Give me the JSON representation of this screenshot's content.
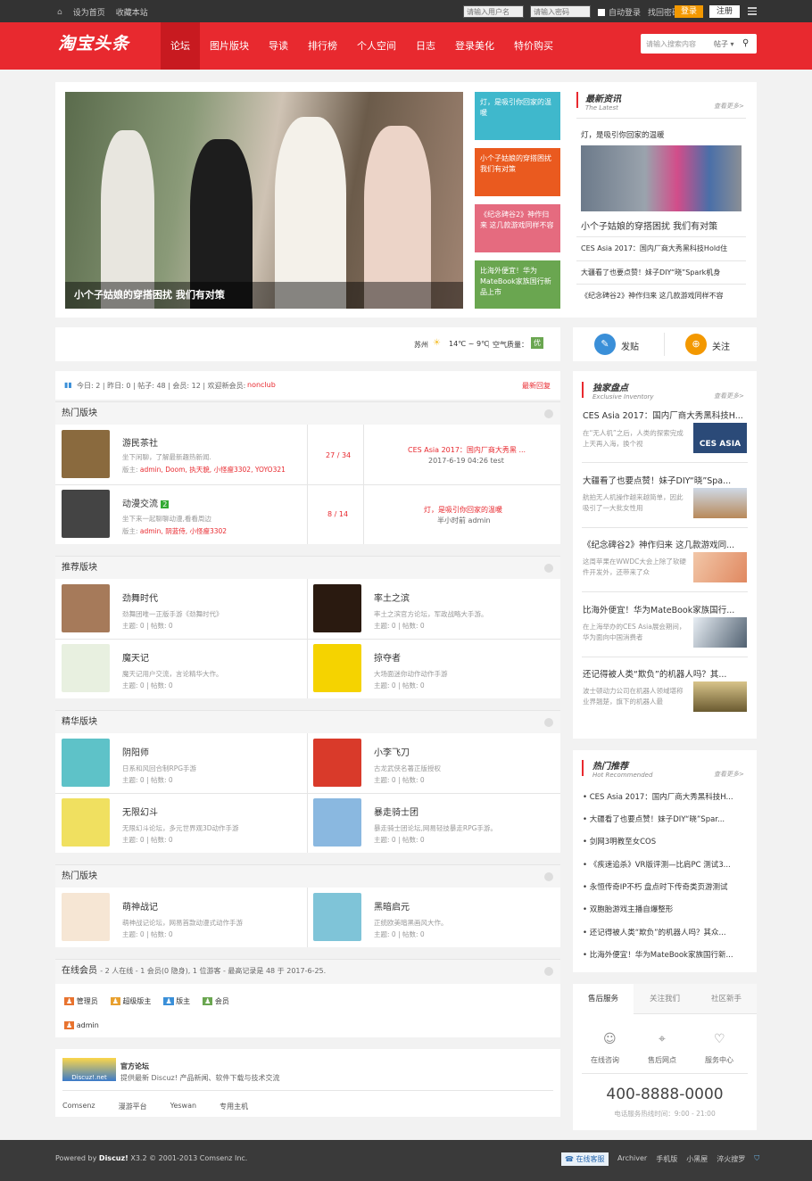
{
  "topbar": {
    "home": "设为首页",
    "fav": "收藏本站",
    "user_ph": "请输入用户名",
    "pwd_ph": "请输入密码",
    "auto": "自动登录",
    "find": "找回密码",
    "login": "登录",
    "register": "注册"
  },
  "header": {
    "logo": "淘宝头条",
    "nav": [
      "论坛",
      "图片版块",
      "导读",
      "排行榜",
      "个人空间",
      "日志",
      "登录美化",
      "特价购买"
    ],
    "search_ph": "请输入搜索内容",
    "search_sel": "帖子"
  },
  "slider": {
    "caption": "小个子姑娘的穿搭困扰 我们有对策"
  },
  "tiles": [
    {
      "text": "灯，是吸引你回家的温暖",
      "color": "#3fb8cc"
    },
    {
      "text": "小个子姑娘的穿搭困扰 我们有对策",
      "color": "#ea5a1f"
    },
    {
      "text": "《纪念碑谷2》神作归来 这几款游戏同样不容",
      "color": "#e56b7f"
    },
    {
      "text": "比海外便宜！华为MateBook家族国行新品上市",
      "color": "#6aa650"
    }
  ],
  "latest": {
    "title": "最新资讯",
    "sub": "The Latest",
    "more": "查看更多>",
    "top": "灯，是吸引你回家的温暖",
    "caption": "小个子姑娘的穿搭困扰 我们有对策",
    "items": [
      "CES Asia 2017：国内厂商大秀黑科技Hold住",
      "大疆看了也要点赞！妹子DIY“晓”Spark机身",
      "《纪念碑谷2》神作归来 这几款游戏同样不容"
    ]
  },
  "weather": {
    "city": "苏州",
    "temp": "14℃ ~ 9℃",
    "air": "空气质量：",
    "level": "优"
  },
  "actions": {
    "post": "发贴",
    "follow": "关注"
  },
  "stats": {
    "text": "今日: 2 | 昨日: 0 | 帖子: 48 | 会员: 12 | 欢迎新会员:",
    "newuser": "nonclub",
    "latest": "最新回复"
  },
  "hot1": {
    "title": "热门版块",
    "forums": [
      {
        "name": "游民茶社",
        "desc": "坐下闲聊，了解最新趣热新闻.",
        "mods_label": "版主:",
        "mods": "admin, Doom, 执天貌, 小怪瘦3302, YOYO321",
        "count": "27 / 34",
        "last": "CES Asia 2017：国内厂商大秀黑 ...",
        "lastmeta": "2017-6-19 04:26 test"
      },
      {
        "name": "动漫交流",
        "badge": "2",
        "desc": "坐下来一起聊聊动漫,看看周边",
        "mods_label": "版主:",
        "mods": "admin, 阴蓝侍, 小怪瘦3302",
        "count": "8 / 14",
        "last": "灯，是吸引你回家的温暖",
        "lastmeta": "半小时前 admin"
      }
    ]
  },
  "rec": {
    "title": "推荐版块",
    "forums": [
      {
        "name": "劲舞时代",
        "desc": "劲舞团唯一正版手游《劲舞时代》",
        "stat": "主题: 0  |  帖数: 0"
      },
      {
        "name": "率土之滨",
        "desc": "率土之滨官方论坛，军政战略大手游。",
        "stat": "主题: 0  |  帖数: 0"
      },
      {
        "name": "魔天记",
        "desc": "魔天记用户交流，言论精华大作。",
        "stat": "主题: 0  |  帖数: 0"
      },
      {
        "name": "掠夺者",
        "desc": "大场面迷你动作动作手游",
        "stat": "主题: 0  |  帖数: 0"
      }
    ]
  },
  "elite": {
    "title": "精华版块",
    "forums": [
      {
        "name": "阴阳师",
        "desc": "日系和风回合制RPG手游",
        "stat": "主题: 0  |  帖数: 0"
      },
      {
        "name": "小李飞刀",
        "desc": "古龙武侠名著正版授权",
        "stat": "主题: 0  |  帖数: 0"
      },
      {
        "name": "无限幻斗",
        "desc": "无限幻斗论坛，多元世界观3D动作手游",
        "stat": "主题: 0  |  帖数: 0"
      },
      {
        "name": "暴走骑士团",
        "desc": "暴走骑士团论坛,网易轻技暴走RPG手游。",
        "stat": "主题: 0  |  帖数: 0"
      }
    ]
  },
  "hot2": {
    "title": "热门版块",
    "forums": [
      {
        "name": "萌神战记",
        "desc": "萌神战记论坛，网易首款动漫式动作手游",
        "stat": "主题: 0  |  帖数: 0"
      },
      {
        "name": "黑暗启元",
        "desc": "正统欧美暗黑画风大作。",
        "stat": "主题: 0  |  帖数: 0"
      }
    ]
  },
  "online": {
    "title": "在线会员",
    "info": "- 2 人在线 - 1 会员(0 隐身), 1 位游客 - 最高记录是 48 于 2017-6-25.",
    "roles": [
      "管理员",
      "超级版主",
      "版主",
      "会员"
    ],
    "user": "admin"
  },
  "official": {
    "badge": "Discuz!.net",
    "name": "官方论坛",
    "desc": "提供最新 Discuz! 产品新闻、软件下载与技术交流",
    "links": [
      "Comsenz",
      "漫游平台",
      "Yeswan",
      "专用主机"
    ]
  },
  "inventory": {
    "title": "独家盘点",
    "sub": "Exclusive Inventory",
    "more": "查看更多>",
    "items": [
      {
        "title": "CES Asia 2017：国内厂商大秀黑科技H...",
        "desc": "在“无人机”之后，人类的探索完成上天再入海，换个视",
        "img": "CES ASIA"
      },
      {
        "title": "大疆看了也要点赞！妹子DIY“晓”Spa...",
        "desc": "航拍无人机操作越来越简单，因此吸引了一大批女性用"
      },
      {
        "title": "《纪念碑谷2》神作归来 这几款游戏同...",
        "desc": "这周苹果在WWDC大会上除了软硬件开发外，还带来了众"
      },
      {
        "title": "比海外便宜！华为MateBook家族国行...",
        "desc": "在上海举办的CES Asia展会期间，华为面向中国消费者"
      },
      {
        "title": "还记得被人类“欺负”的机器人吗？其...",
        "desc": "波士顿动力公司在机器人领域堪称业界翘楚，旗下的机器人最"
      }
    ]
  },
  "recommend": {
    "title": "热门推荐",
    "sub": "Hot Recommended",
    "more": "查看更多>",
    "items": [
      "CES Asia 2017：国内厂商大秀黑科技H...",
      "大疆看了也要点赞！妹子DIY“晓”Spar...",
      "剑网3明教至女COS",
      "《疾速追杀》VR版评测—比肩PC 测试3...",
      "永恒传奇IP不朽 盘点时下传奇类页游测试",
      "双胞胎游戏主播自爆整形",
      "还记得被人类“欺负”的机器人吗？其众...",
      "比海外便宜！华为MateBook家族国行新..."
    ]
  },
  "service": {
    "tabs": [
      "售后服务",
      "关注我们",
      "社区新手"
    ],
    "items": [
      "在线咨询",
      "售后网点",
      "服务中心"
    ],
    "phone": "400-8888-0000",
    "hours": "电话服务热线时间：9:00 - 21:00"
  },
  "footer": {
    "powered": "Powered by",
    "brand": "Discuz!",
    "ver": "X3.2  © 2001-2013 Comsenz Inc.",
    "chat": "在线客服",
    "links": [
      "Archiver",
      "手机版",
      "小黑屋",
      "淬火搜罗"
    ]
  }
}
